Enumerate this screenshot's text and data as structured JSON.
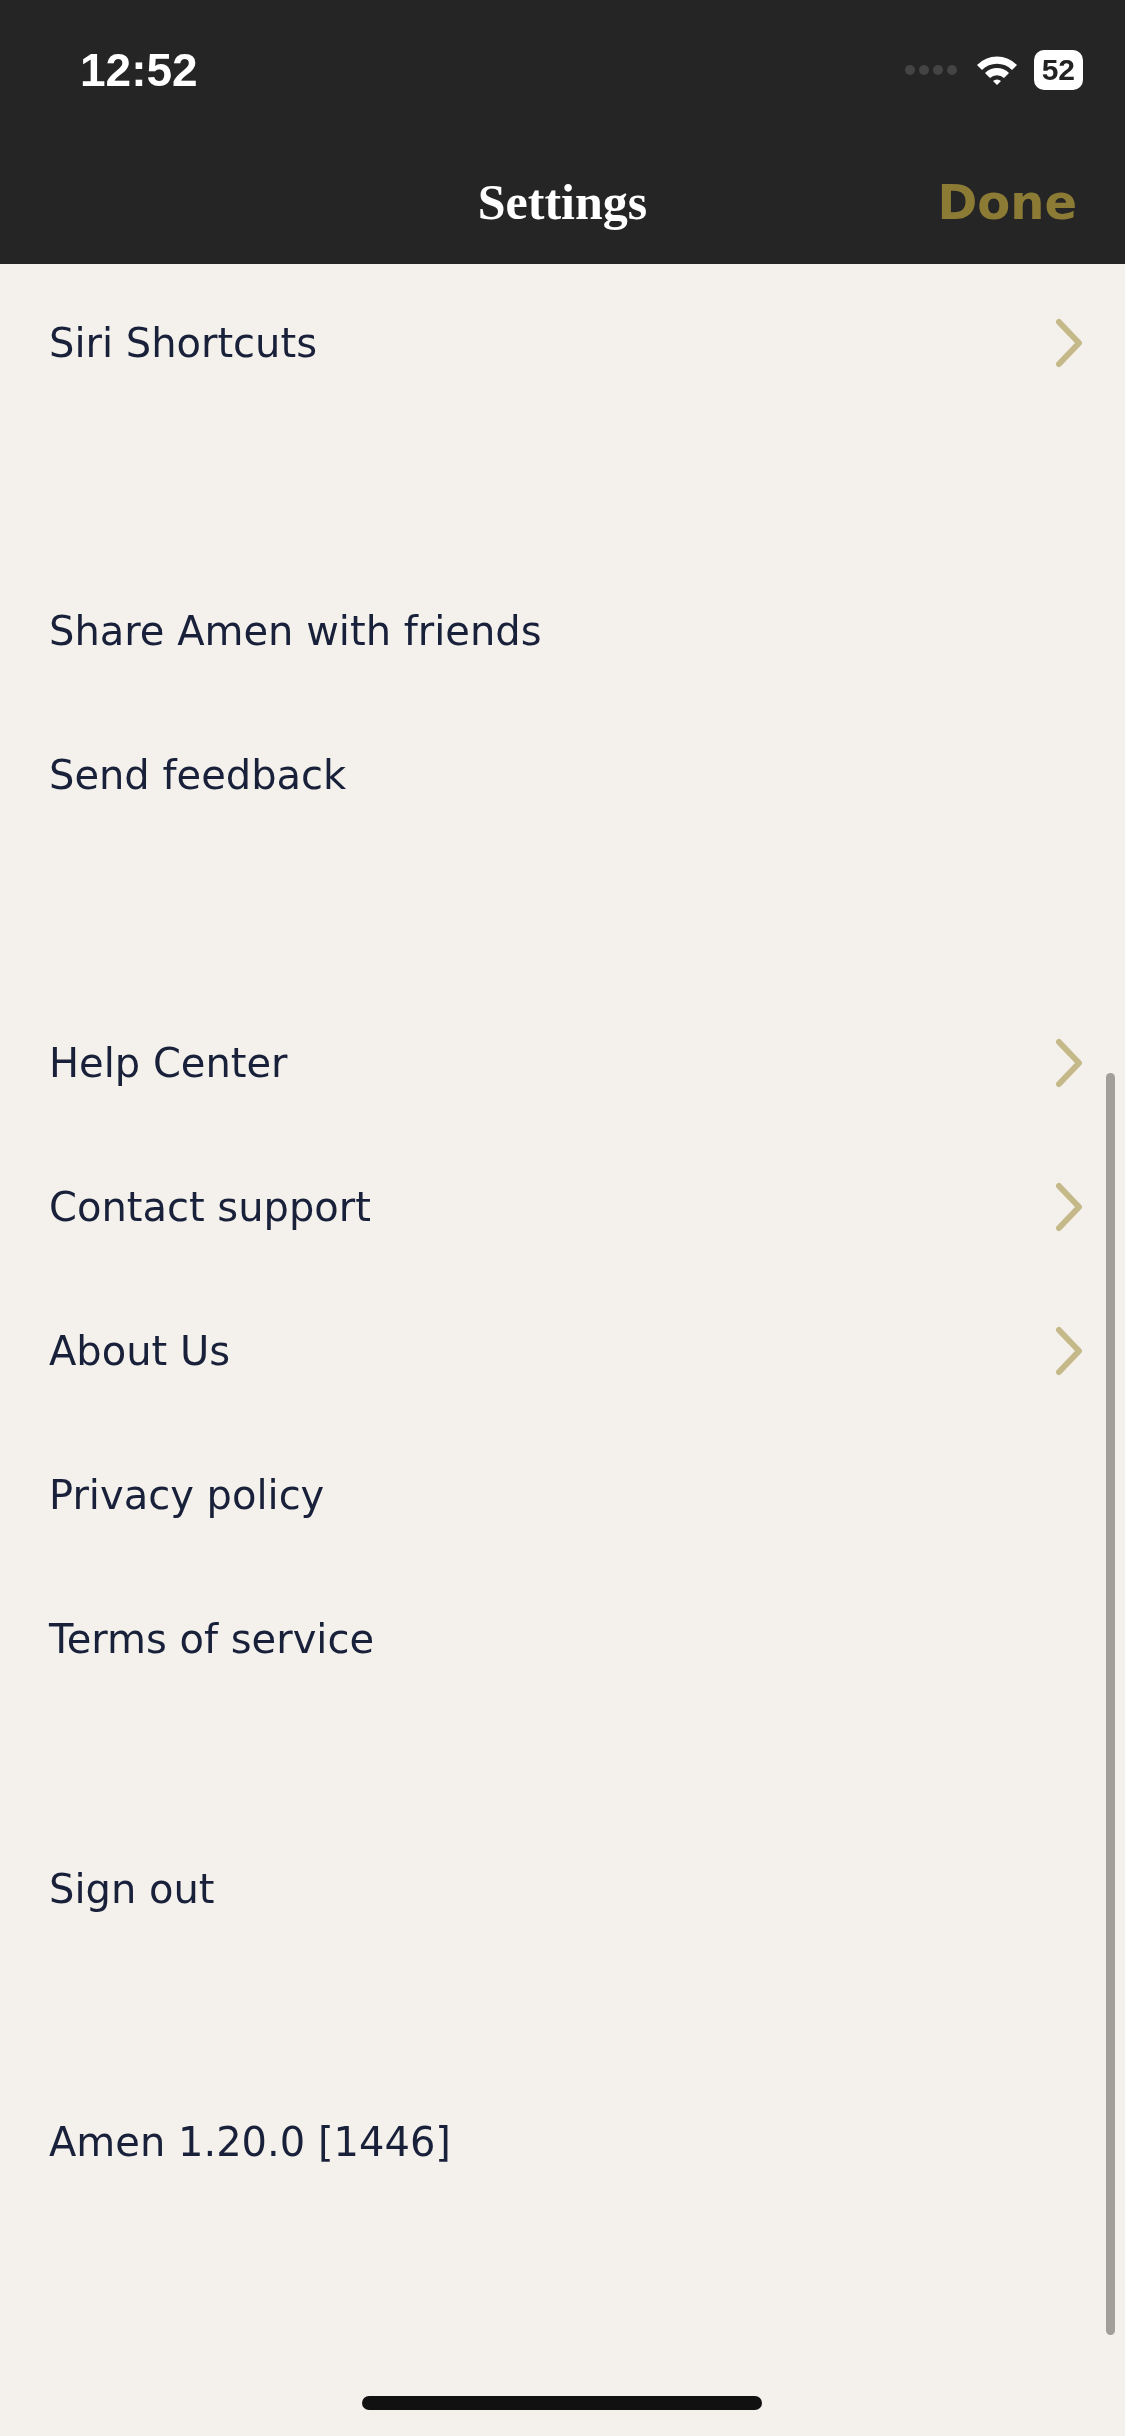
{
  "status_bar": {
    "time": "12:52",
    "battery": "52"
  },
  "nav": {
    "title": "Settings",
    "done": "Done"
  },
  "sections": [
    {
      "items": [
        {
          "label": "Siri Shortcuts",
          "chevron": true
        }
      ]
    },
    {
      "items": [
        {
          "label": "Share Amen with friends",
          "chevron": false
        },
        {
          "label": "Send feedback",
          "chevron": false
        }
      ]
    },
    {
      "items": [
        {
          "label": "Help Center",
          "chevron": true
        },
        {
          "label": "Contact support",
          "chevron": true
        },
        {
          "label": "About Us",
          "chevron": true
        },
        {
          "label": "Privacy policy",
          "chevron": false
        },
        {
          "label": "Terms of service",
          "chevron": false
        }
      ]
    },
    {
      "items": [
        {
          "label": "Sign out",
          "chevron": false
        }
      ]
    },
    {
      "items": [
        {
          "label": "Amen 1.20.0 [1446]",
          "chevron": false
        }
      ]
    }
  ]
}
